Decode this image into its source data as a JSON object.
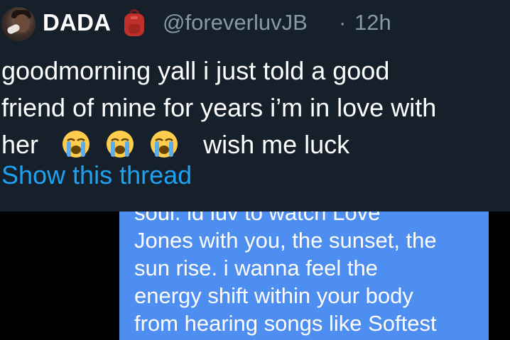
{
  "tweet": {
    "display_name": "DADA",
    "handle": "@foreverluvJB",
    "separator": "·",
    "time": "12h",
    "badge_icon": "backpack-icon",
    "text_lines": [
      "goodmorning yall i just told a good",
      "friend of mine for years i’m in love with",
      "her",
      "wish me luck"
    ],
    "emoji": [
      "loudly-crying-face-icon",
      "loudly-crying-face-icon",
      "loudly-crying-face-icon"
    ],
    "show_thread": "Show this thread"
  },
  "message": {
    "lines": [
      "soul. id luv to watch Love",
      "Jones with you, the sunset, the",
      "sun rise. i wanna feel the",
      "energy shift within your body",
      "from hearing songs like Softest"
    ]
  },
  "colors": {
    "card_background": "#15202b",
    "link": "#1da1f2",
    "secondary_text": "#8899a6",
    "message_bubble": "#4e8ef0",
    "backdrop": "#000000"
  }
}
